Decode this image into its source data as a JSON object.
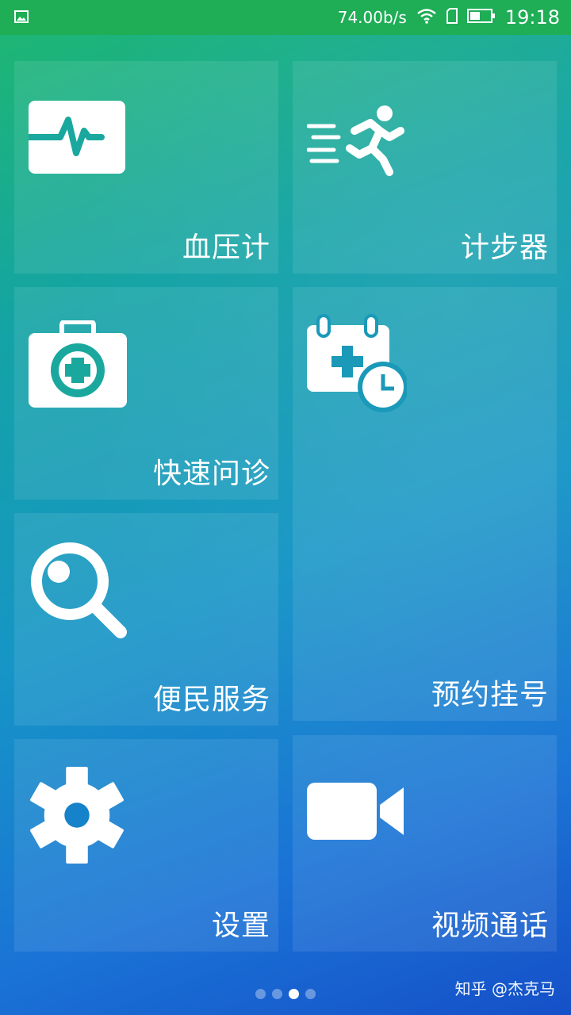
{
  "status_bar": {
    "network_speed": "74.00b/s",
    "time": "19:18",
    "icons": [
      "image-icon",
      "wifi-icon",
      "sim-icon",
      "battery-icon"
    ]
  },
  "tiles": [
    {
      "label": "血压计",
      "icon": "heart-monitor-icon"
    },
    {
      "label": "计步器",
      "icon": "running-person-icon"
    },
    {
      "label": "快速问诊",
      "icon": "medical-kit-icon"
    },
    {
      "label": "预约挂号",
      "icon": "calendar-clock-icon"
    },
    {
      "label": "便民服务",
      "icon": "search-icon"
    },
    {
      "label": "设置",
      "icon": "gear-icon"
    },
    {
      "label": "视频通话",
      "icon": "video-camera-icon"
    }
  ],
  "pagination": {
    "total": 4,
    "active": 3
  },
  "watermark": "知乎 @杰克马",
  "colors": {
    "status_bar": "#1fad56",
    "tile_bg": "rgba(255,255,255,0.09)",
    "text": "#ffffff"
  }
}
